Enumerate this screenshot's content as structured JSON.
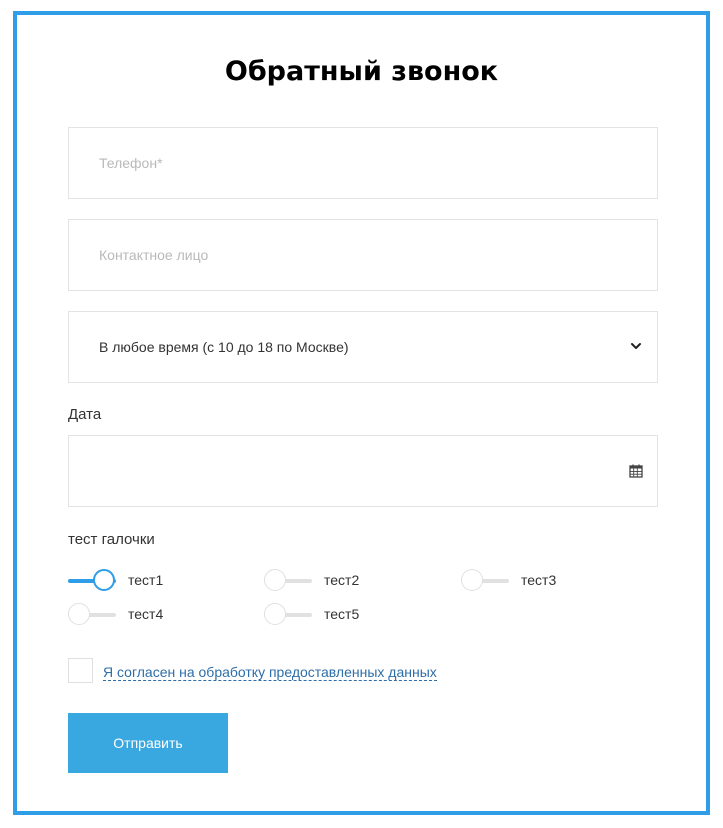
{
  "form": {
    "title": "Обратный звонок",
    "phone_placeholder": "Телефон*",
    "contact_placeholder": "Контактное лицо",
    "time_select_value": "В любое время (с 10 до 18 по Москве)",
    "date_label": "Дата",
    "date_value": "",
    "checks_label": "тест галочки",
    "toggles": [
      {
        "label": "тест1",
        "checked": true
      },
      {
        "label": "тест2",
        "checked": false
      },
      {
        "label": "тест3",
        "checked": false
      },
      {
        "label": "тест4",
        "checked": false
      },
      {
        "label": "тест5",
        "checked": false
      }
    ],
    "consent_text": "Я согласен на обработку предоставленных данных",
    "submit_label": "Отправить"
  },
  "colors": {
    "frame_border": "#2f9de8",
    "accent": "#2f9de8",
    "submit_bg": "#3aa8e0",
    "link": "#2d6ea8"
  },
  "icons": [
    "chevron-down-icon",
    "calendar-icon"
  ]
}
